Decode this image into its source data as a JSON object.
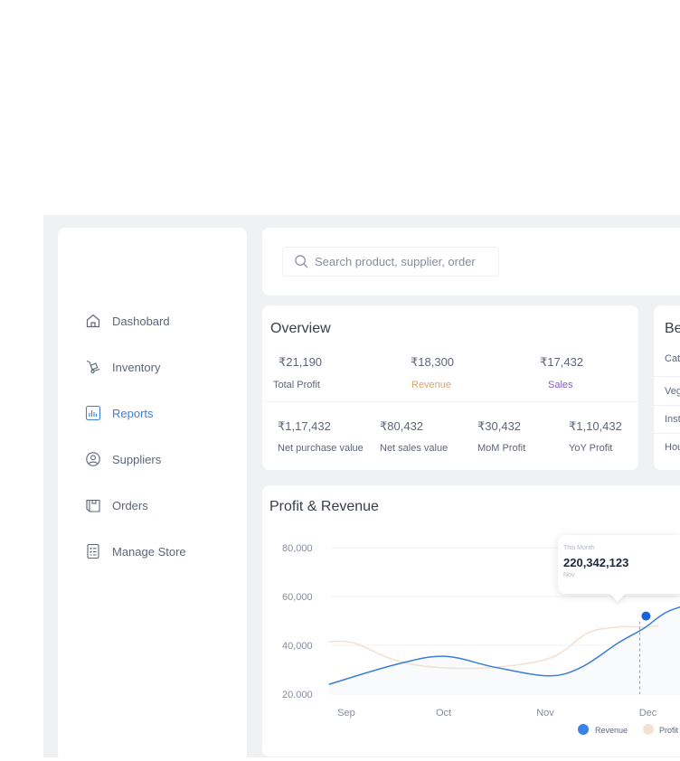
{
  "sidebar": {
    "items": [
      {
        "label": "Dashobard",
        "icon": "home-icon",
        "active": false
      },
      {
        "label": "Inventory",
        "icon": "hand-truck-icon",
        "active": false
      },
      {
        "label": "Reports",
        "icon": "bar-chart-icon",
        "active": true
      },
      {
        "label": "Suppliers",
        "icon": "user-circle-icon",
        "active": false
      },
      {
        "label": "Orders",
        "icon": "box-icon",
        "active": false
      },
      {
        "label": "Manage Store",
        "icon": "clipboard-list-icon",
        "active": false
      }
    ]
  },
  "search": {
    "placeholder": "Search product, supplier, order",
    "value": ""
  },
  "overview": {
    "title": "Overview",
    "top": [
      {
        "value": "₹21,190",
        "label": "Total Profit",
        "color": "#5d6679"
      },
      {
        "value": "₹18,300",
        "label": "Revenue",
        "color": "#dba362"
      },
      {
        "value": "₹17,432",
        "label": "Sales",
        "color": "#845ebc"
      }
    ],
    "bottom": [
      {
        "value": "₹1,17,432",
        "label": "Net purchase value"
      },
      {
        "value": "₹80,432",
        "label": "Net sales value"
      },
      {
        "value": "₹30,432",
        "label": "MoM Profit"
      },
      {
        "value": "₹1,10,432",
        "label": "YoY Profit"
      }
    ]
  },
  "best_selling": {
    "title": "Be",
    "rows": [
      "Cat",
      "Veg",
      "Inst",
      "Hou"
    ]
  },
  "chart": {
    "title": "Profit  & Revenue",
    "tooltip": {
      "label": "This Month",
      "value": "220,342,123",
      "sub": "Nov"
    }
  },
  "colors": {
    "revenue": "#3b82e6",
    "profit": "#f1e3d3",
    "active_nav": "#3d7fd9"
  },
  "chart_data": {
    "type": "line",
    "title": "Profit  & Revenue",
    "xlabel": "",
    "ylabel": "",
    "categories": [
      "Sep",
      "Oct",
      "Nov",
      "Dec"
    ],
    "ytick_labels": [
      "80,000",
      "60,000",
      "40,000",
      "20.000"
    ],
    "yticks": [
      80000,
      60000,
      40000,
      20000
    ],
    "ylim": [
      20000,
      80000
    ],
    "grid": true,
    "legend": "bottom-right",
    "x": [
      -0.17,
      0.47,
      0.95,
      1.45,
      1.97,
      2.29,
      2.65,
      2.9,
      3.14,
      3.49,
      3.66
    ],
    "series": [
      {
        "name": "Revenue",
        "color": "#3b82e6",
        "x": [
          -0.17,
          0.47,
          0.95,
          1.45,
          1.97,
          2.29,
          2.65,
          2.9,
          3.14,
          3.49,
          3.66
        ],
        "values": [
          24000,
          32000,
          35500,
          31000,
          27500,
          31000,
          41000,
          47000,
          54000,
          58000,
          58000
        ]
      },
      {
        "name": "Profit",
        "color": "#f1e3d3",
        "x": [
          -0.17,
          0.07,
          0.47,
          0.87,
          1.45,
          2.0,
          2.35,
          2.65,
          2.9,
          3.04
        ],
        "values": [
          41500,
          41000,
          34000,
          31000,
          31000,
          35000,
          45000,
          47500,
          47500,
          48000
        ]
      }
    ],
    "highlight": {
      "x": 2.92,
      "value": 52000,
      "label": "This Month",
      "display": "220,342,123",
      "period": "Nov"
    }
  }
}
